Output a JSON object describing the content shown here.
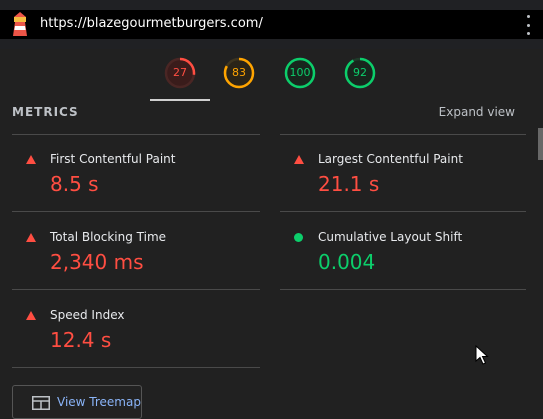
{
  "browser": {
    "url": "https://blazegourmetburgers.com/"
  },
  "gauges": [
    {
      "score": "27",
      "color": "#ff4e42",
      "fraction": 0.27
    },
    {
      "score": "83",
      "color": "#ffa400",
      "fraction": 0.83
    },
    {
      "score": "100",
      "color": "#0cce6b",
      "fraction": 1.0
    },
    {
      "score": "92",
      "color": "#0cce6b",
      "fraction": 0.92
    }
  ],
  "metrics": {
    "title": "METRICS",
    "expand_label": "Expand view",
    "items": [
      {
        "label": "First Contentful Paint",
        "value": "8.5 s",
        "status": "fail"
      },
      {
        "label": "Largest Contentful Paint",
        "value": "21.1 s",
        "status": "fail"
      },
      {
        "label": "Total Blocking Time",
        "value": "2,340 ms",
        "status": "fail"
      },
      {
        "label": "Cumulative Layout Shift",
        "value": "0.004",
        "status": "pass"
      },
      {
        "label": "Speed Index",
        "value": "12.4 s",
        "status": "fail"
      }
    ]
  },
  "treemap": {
    "label": "View Treemap"
  },
  "colors": {
    "fail": "#ff4e42",
    "average": "#ffa400",
    "pass": "#0cce6b",
    "link": "#8ab4f8"
  }
}
